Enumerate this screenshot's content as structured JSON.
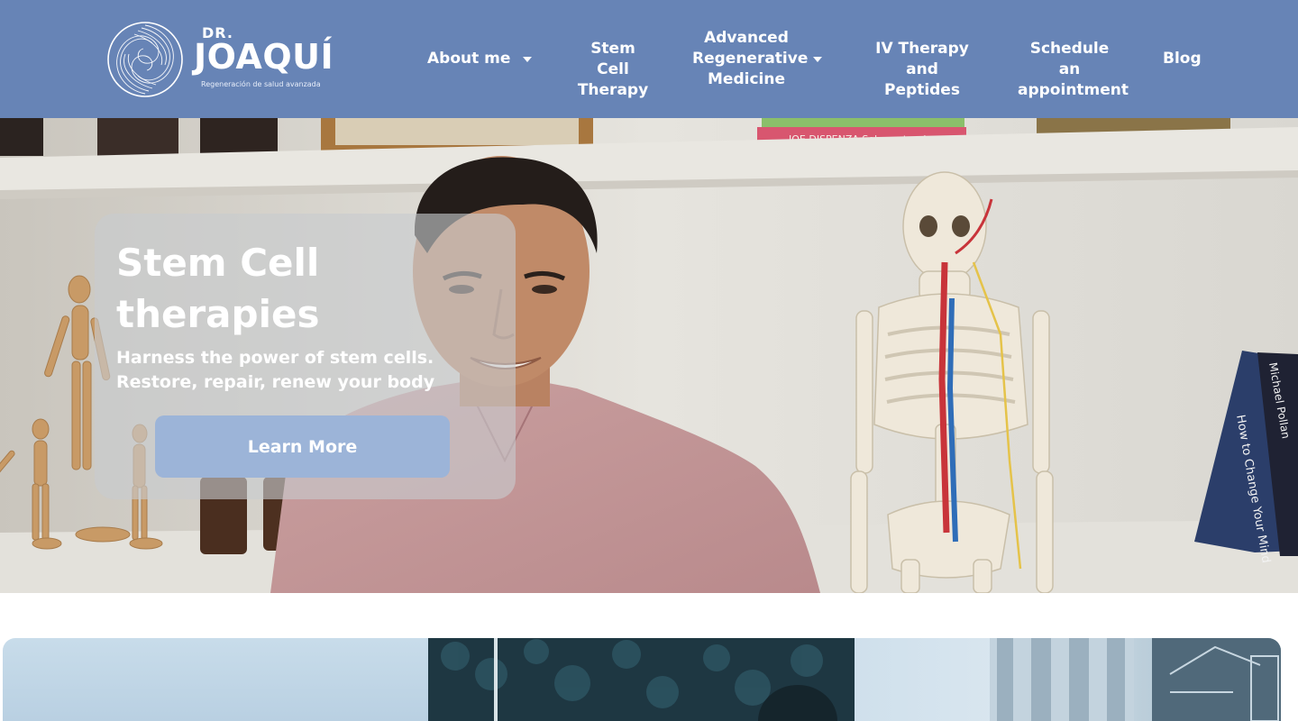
{
  "header": {
    "logo": {
      "prefix": "DR.",
      "name": "JOAQUÍ",
      "tagline": "Regeneración de salud avanzada",
      "mark_icon": "spiral-logo-icon"
    },
    "nav": [
      {
        "label": "About me",
        "has_dropdown": true
      },
      {
        "label": "Stem Cell\nTherapy",
        "has_dropdown": false
      },
      {
        "label": "Advanced\nRegenerative\nMedicine",
        "has_dropdown": true
      },
      {
        "label": "IV Therapy\nand Peptides",
        "has_dropdown": false
      },
      {
        "label": "Schedule an\nappointment",
        "has_dropdown": false
      },
      {
        "label": "Blog",
        "has_dropdown": false
      }
    ]
  },
  "hero": {
    "title": "Stem Cell therapies",
    "subtitle": "Harness the power of stem cells. Restore, repair, renew your body",
    "cta_label": "Learn More",
    "shelf_book_text": "JOE DISPENZA Sobrenatural",
    "side_book_title": "How to Change Your Mind",
    "side_book_author": "Michael Pollan"
  },
  "colors": {
    "header_bg": "#6784b6",
    "button_bg": "#9cb4d8",
    "text_on_dark": "#ffffff"
  }
}
